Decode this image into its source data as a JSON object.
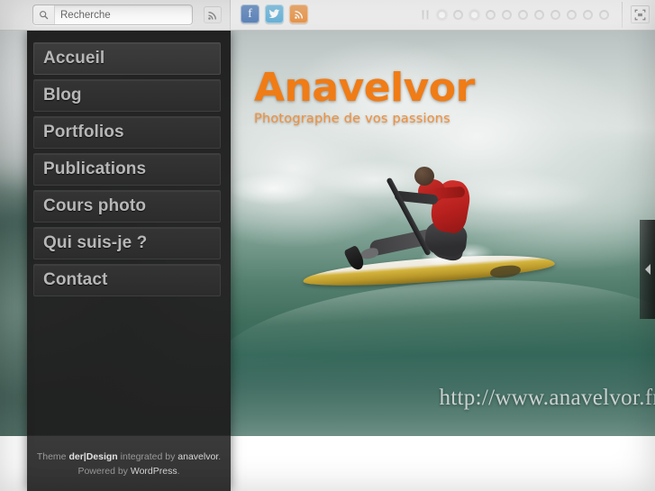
{
  "topbar": {
    "search": {
      "placeholder": "Recherche",
      "value": "",
      "icon": "search-icon"
    },
    "feed_icon": "rss-icon",
    "social": [
      {
        "name": "facebook",
        "glyph": "f",
        "color": "#5d83b8"
      },
      {
        "name": "twitter",
        "glyph": "❧",
        "color": "#68b2d8"
      },
      {
        "name": "rss",
        "glyph": "◜",
        "color": "#e8954a"
      }
    ],
    "pager": {
      "pause_icon": "pause-icon",
      "total_dots": 11,
      "active_index": 3
    },
    "fullscreen_icon": "fullscreen-icon"
  },
  "sidebar": {
    "items": [
      {
        "label": "Accueil",
        "active": true
      },
      {
        "label": "Blog",
        "active": false
      },
      {
        "label": "Portfolios",
        "active": false
      },
      {
        "label": "Publications",
        "active": false
      },
      {
        "label": "Cours photo",
        "active": false
      },
      {
        "label": "Qui suis-je ?",
        "active": false
      },
      {
        "label": "Contact",
        "active": false
      }
    ]
  },
  "footer": {
    "line1_prefix": "Theme ",
    "theme_name": "der|Design",
    "line1_middle": " integrated by ",
    "author": "anavelvor",
    "line1_suffix": ".",
    "line2_prefix": "Powered by ",
    "platform": "WordPress",
    "line2_suffix": "."
  },
  "slide": {
    "logo_title": "Anavelvor",
    "logo_subtitle": "Photographe de vos passions",
    "watermark": "http://www.anavelvor.fr",
    "next_arrow_icon": "chevron-right-icon",
    "logo_color": "#f07c16"
  }
}
